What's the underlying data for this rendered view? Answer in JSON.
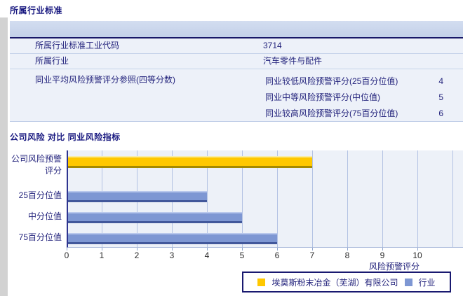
{
  "sections": {
    "industry_standard_title": "所属行业标准",
    "comparison_title": "公司风险 对比 同业风险指标"
  },
  "table": {
    "rows": [
      {
        "label": "所属行业标准工业代码",
        "value": "3714"
      },
      {
        "label": "所属行业",
        "value": "汽车零件与配件"
      }
    ],
    "group_row": {
      "label": "同业平均风险预警评分参照(四等分数)",
      "sub_rows": [
        {
          "label": "同业较低风险预警评分(25百分位值)",
          "value": "4"
        },
        {
          "label": "同业中等风险预警评分(中位值)",
          "value": "5"
        },
        {
          "label": "同业较高风险预警评分(75百分位值)",
          "value": "6"
        }
      ]
    }
  },
  "chart_data": {
    "type": "bar",
    "orientation": "horizontal",
    "title": "公司风险 对比 同业风险指标",
    "categories": [
      "公司风险预警评分",
      "25百分位值",
      "中分位值",
      "75百分位值"
    ],
    "category_labels": [
      "公司风险预警\n评分",
      "25百分位值",
      "中分位值",
      "75百分位值"
    ],
    "values": [
      7,
      4,
      5,
      6
    ],
    "series_of_bar": [
      "company",
      "industry",
      "industry",
      "industry"
    ],
    "xlabel": "风险预警评分",
    "xlim": [
      0,
      10
    ],
    "xticks": [
      0,
      1,
      2,
      3,
      4,
      5,
      6,
      7,
      8,
      9,
      10
    ],
    "grid": "vertical",
    "colors": {
      "company_bar": "#ffc800",
      "industry_bar": "#7e97d3",
      "plot_background": "#edf1f8",
      "gridline": "#b3c2e3",
      "axis_text": "#23237c"
    },
    "legend": [
      {
        "name": "company",
        "label": "埃莫斯粉末冶金（芜湖）有限公司",
        "color": "#ffc800"
      },
      {
        "name": "industry",
        "label": "行业",
        "color": "#7e97d3"
      }
    ],
    "legend_position": "bottom-right"
  }
}
